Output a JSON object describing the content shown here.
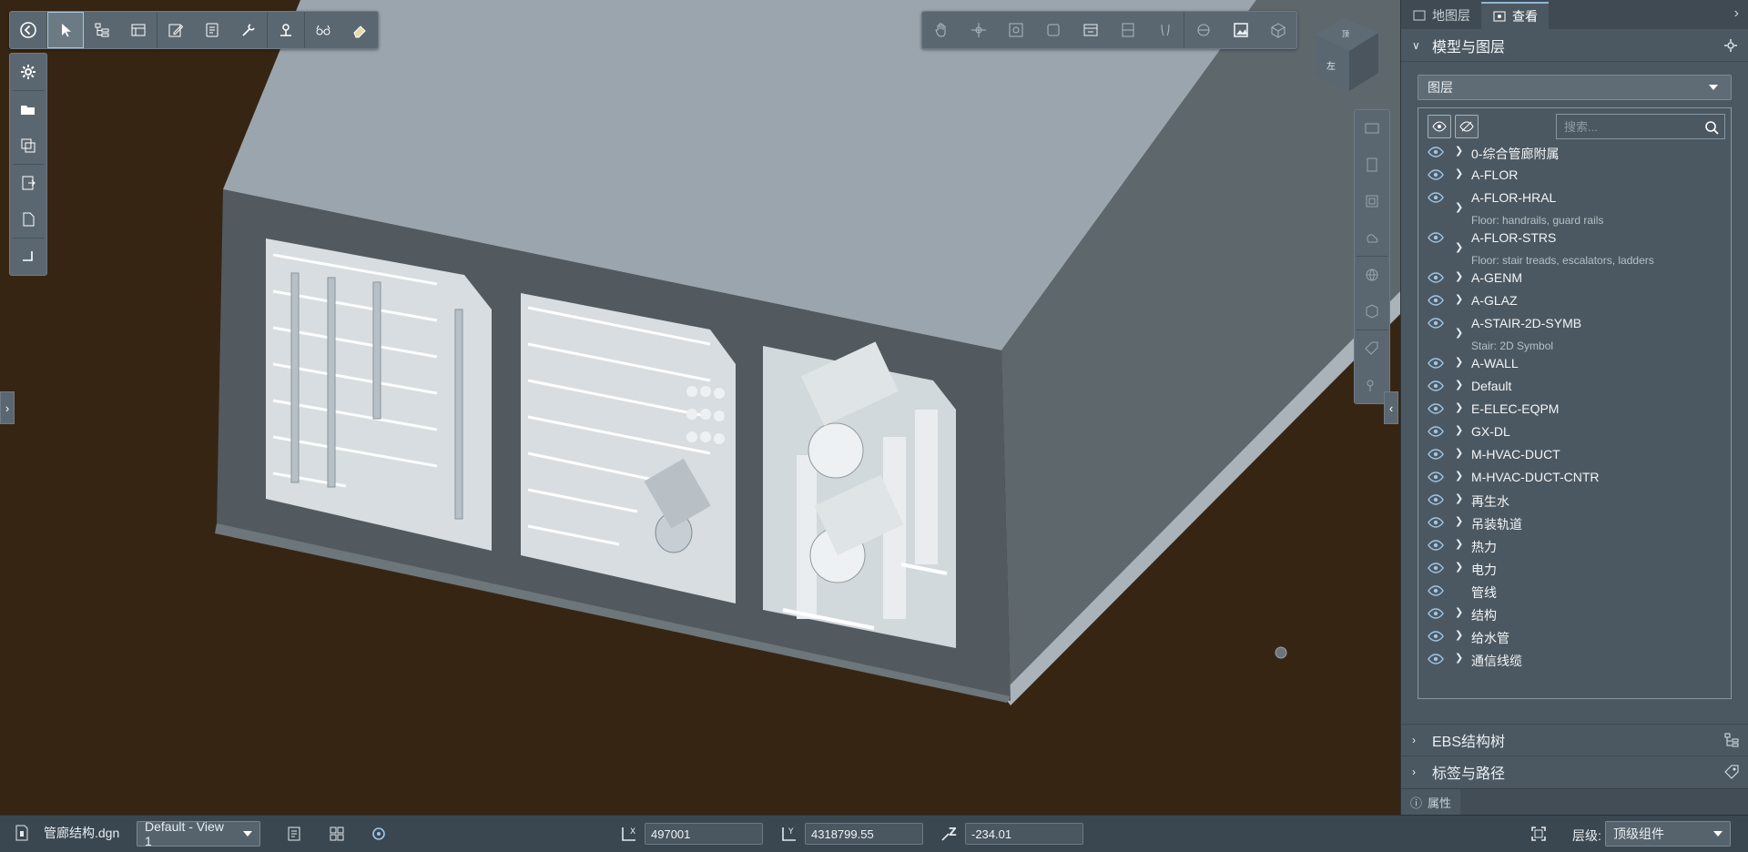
{
  "toolbar_main": {
    "icons": [
      "back-icon",
      "select-icon",
      "tree-icon",
      "properties-icon",
      "markup-icon",
      "measure-icon",
      "tools-icon",
      "location-icon",
      "glasses-icon",
      "eraser-icon"
    ]
  },
  "view_toolbar": {
    "icons": [
      "hand-icon",
      "orbit-icon",
      "zoom-extents-icon",
      "zoom-window-icon",
      "camera-icon",
      "section-icon",
      "walk-icon",
      "render-icon",
      "layers-view-icon",
      "fit-icon"
    ]
  },
  "nav_cube": {
    "face_top": "顶",
    "face_left": "左"
  },
  "panel": {
    "tabs": [
      {
        "label": "地图层",
        "active": false
      },
      {
        "label": "查看",
        "active": true
      }
    ],
    "section_title": "模型与图层",
    "layer_select": "图层",
    "search_placeholder": "搜索...",
    "layers": [
      {
        "name": "0-综合管廊附属",
        "desc": "",
        "expandable": true
      },
      {
        "name": "A-FLOR",
        "desc": "",
        "expandable": true
      },
      {
        "name": "A-FLOR-HRAL",
        "desc": "Floor: handrails, guard rails",
        "expandable": true
      },
      {
        "name": "A-FLOR-STRS",
        "desc": "Floor: stair treads, escalators, ladders",
        "expandable": true
      },
      {
        "name": "A-GENM",
        "desc": "",
        "expandable": true
      },
      {
        "name": "A-GLAZ",
        "desc": "",
        "expandable": true
      },
      {
        "name": "A-STAIR-2D-SYMB",
        "desc": "Stair: 2D Symbol",
        "expandable": true
      },
      {
        "name": "A-WALL",
        "desc": "",
        "expandable": true
      },
      {
        "name": "Default",
        "desc": "",
        "expandable": true
      },
      {
        "name": "E-ELEC-EQPM",
        "desc": "",
        "expandable": true
      },
      {
        "name": "GX-DL",
        "desc": "",
        "expandable": true
      },
      {
        "name": "M-HVAC-DUCT",
        "desc": "",
        "expandable": true
      },
      {
        "name": "M-HVAC-DUCT-CNTR",
        "desc": "",
        "expandable": true
      },
      {
        "name": "再生水",
        "desc": "",
        "expandable": true
      },
      {
        "name": "吊装轨道",
        "desc": "",
        "expandable": true
      },
      {
        "name": "热力",
        "desc": "",
        "expandable": true
      },
      {
        "name": "电力",
        "desc": "",
        "expandable": true
      },
      {
        "name": "管线",
        "desc": "",
        "expandable": false
      },
      {
        "name": "结构",
        "desc": "",
        "expandable": true
      },
      {
        "name": "给水管",
        "desc": "",
        "expandable": true
      },
      {
        "name": "通信线缆",
        "desc": "",
        "expandable": true
      }
    ],
    "ebs_title": "EBS结构树",
    "tags_title": "标签与路径",
    "properties_tab": "属性"
  },
  "status": {
    "file_name": "管廊结构.dgn",
    "view_select": "Default - View 1",
    "x_value": "497001",
    "y_value": "4318799.55",
    "z_value": "-234.01",
    "level_label": "层级:",
    "level_select": "顶级组件"
  }
}
